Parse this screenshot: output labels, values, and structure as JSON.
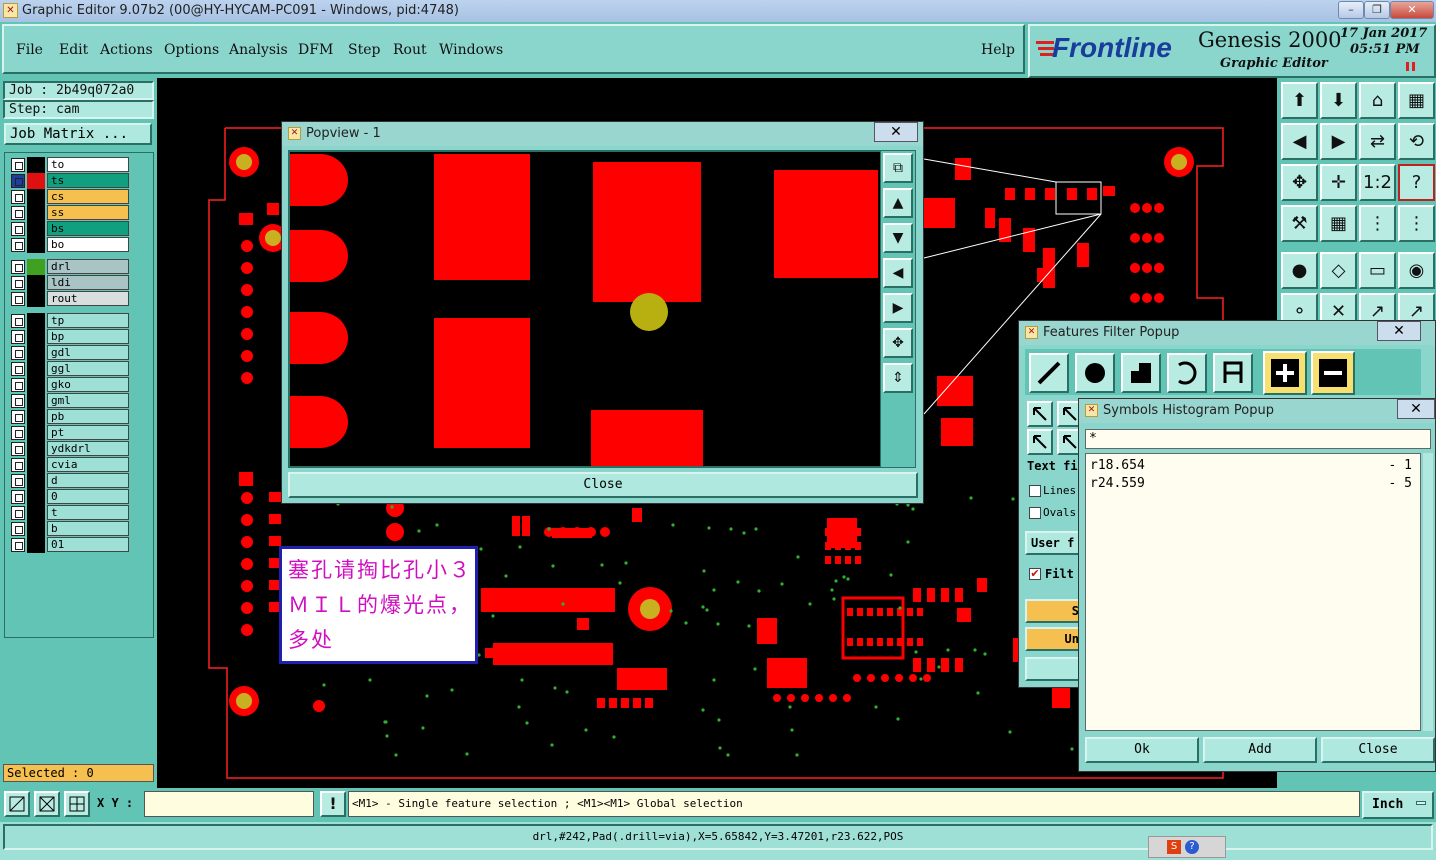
{
  "window": {
    "title": "Graphic Editor 9.07b2 (00@HY-HYCAM-PC091 - Windows, pid:4748)",
    "minimize": "–",
    "maximize": "❐",
    "close": "✕"
  },
  "menu": {
    "file": "File",
    "edit": "Edit",
    "actions": "Actions",
    "options": "Options",
    "analysis": "Analysis",
    "dfm": "DFM",
    "step": "Step",
    "rout": "Rout",
    "windows": "Windows",
    "help": "Help"
  },
  "brand": {
    "logo": "Frontline",
    "product": "Genesis 2000",
    "subtitle": "Graphic Editor",
    "date": "17 Jan 2017",
    "time": "05:51 PM"
  },
  "job": {
    "job_label": "Job : 2b49q072a0",
    "step_label": "Step: cam",
    "matrix_button": "Job Matrix ..."
  },
  "layers_group1": [
    {
      "name": "to",
      "color": "#ffffff"
    },
    {
      "name": "ts",
      "color": "#10a080"
    },
    {
      "name": "cs",
      "color": "#f5c050"
    },
    {
      "name": "ss",
      "color": "#f5c050"
    },
    {
      "name": "bs",
      "color": "#10a080"
    },
    {
      "name": "bo",
      "color": "#ffffff"
    }
  ],
  "layers_group2": [
    {
      "name": "drl",
      "color": "#a8c4c4"
    },
    {
      "name": "ldi",
      "color": "#a8c4c4"
    },
    {
      "name": "rout",
      "color": "#d8dede"
    }
  ],
  "layers_group3": [
    {
      "name": "tp"
    },
    {
      "name": "bp"
    },
    {
      "name": "gdl"
    },
    {
      "name": "ggl"
    },
    {
      "name": "gko"
    },
    {
      "name": "gml"
    },
    {
      "name": "pb"
    },
    {
      "name": "pt"
    },
    {
      "name": "ydkdrl"
    },
    {
      "name": "cvia"
    },
    {
      "name": "d"
    },
    {
      "name": "0"
    },
    {
      "name": "t"
    },
    {
      "name": "b"
    },
    {
      "name": "01"
    }
  ],
  "selected": "Selected : 0",
  "popview": {
    "title": "Popview - 1",
    "close_x": "✕",
    "close_button": "Close"
  },
  "annotation": {
    "text": "塞孔请掏比孔小３ＭＩＬ的爆光点，多处"
  },
  "features_filter": {
    "title": "Features Filter Popup",
    "close_x": "✕",
    "text_filter": "Text fi",
    "lines": "Lines",
    "ovals": "Ovals",
    "user": "User f",
    "filter": "Filt",
    "btn1": "S",
    "btn2": "Un"
  },
  "symbols_histogram": {
    "title": "Symbols Histogram Popup",
    "close_x": "✕",
    "filter": "*",
    "rows": [
      {
        "symbol": "r18.654",
        "count": "- 1"
      },
      {
        "symbol": "r24.559",
        "count": "- 5"
      }
    ],
    "ok": "Ok",
    "add": "Add",
    "close": "Close"
  },
  "bottom": {
    "xy_label": "X Y :",
    "xy_value": "",
    "hint": "<M1> - Single feature selection ; <M1><M1> Global selection",
    "units": "Inch",
    "status": "drl,#242,Pad(.drill=via),X=5.65842,Y=3.47201,r23.622,POS"
  },
  "colors": {
    "pcb_red": "#ff0000",
    "via_gold": "#c8b020",
    "teal": "#62c4b4"
  }
}
